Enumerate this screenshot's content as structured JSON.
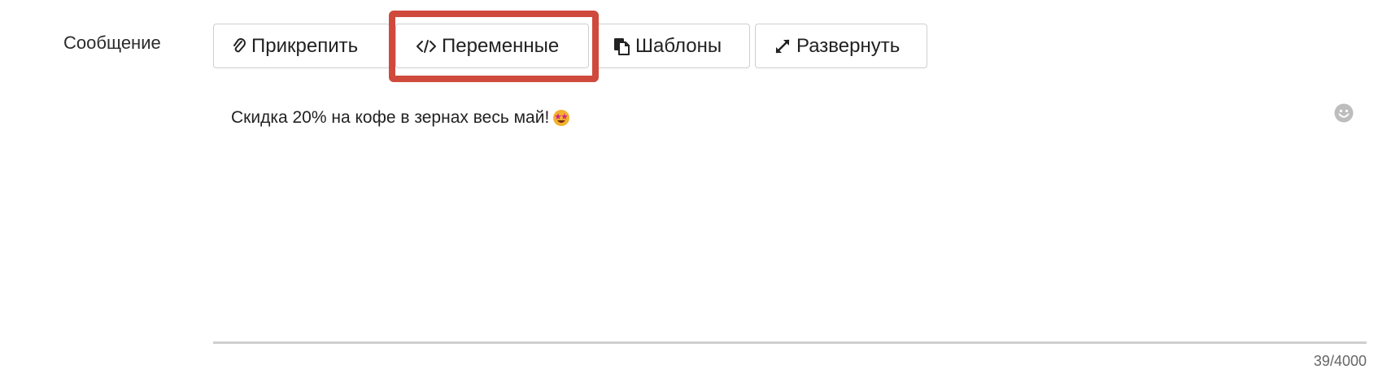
{
  "message_field": {
    "label": "Сообщение",
    "text": "Скидка 20% на кофе в зернах весь май!",
    "counter": "39/4000"
  },
  "toolbar": {
    "buttons": [
      {
        "label": "Прикрепить",
        "icon": "paperclip-icon"
      },
      {
        "label": "Переменные",
        "icon": "code-icon"
      },
      {
        "label": "Шаблоны",
        "icon": "copy-icon"
      },
      {
        "label": "Развернуть",
        "icon": "expand-icon"
      }
    ]
  },
  "highlight": {
    "target": "Переменные",
    "color": "#cf4a3c"
  },
  "icons": {
    "inline_emoji": "star-struck-emoji-icon",
    "emoji_picker": "smiley-icon"
  }
}
